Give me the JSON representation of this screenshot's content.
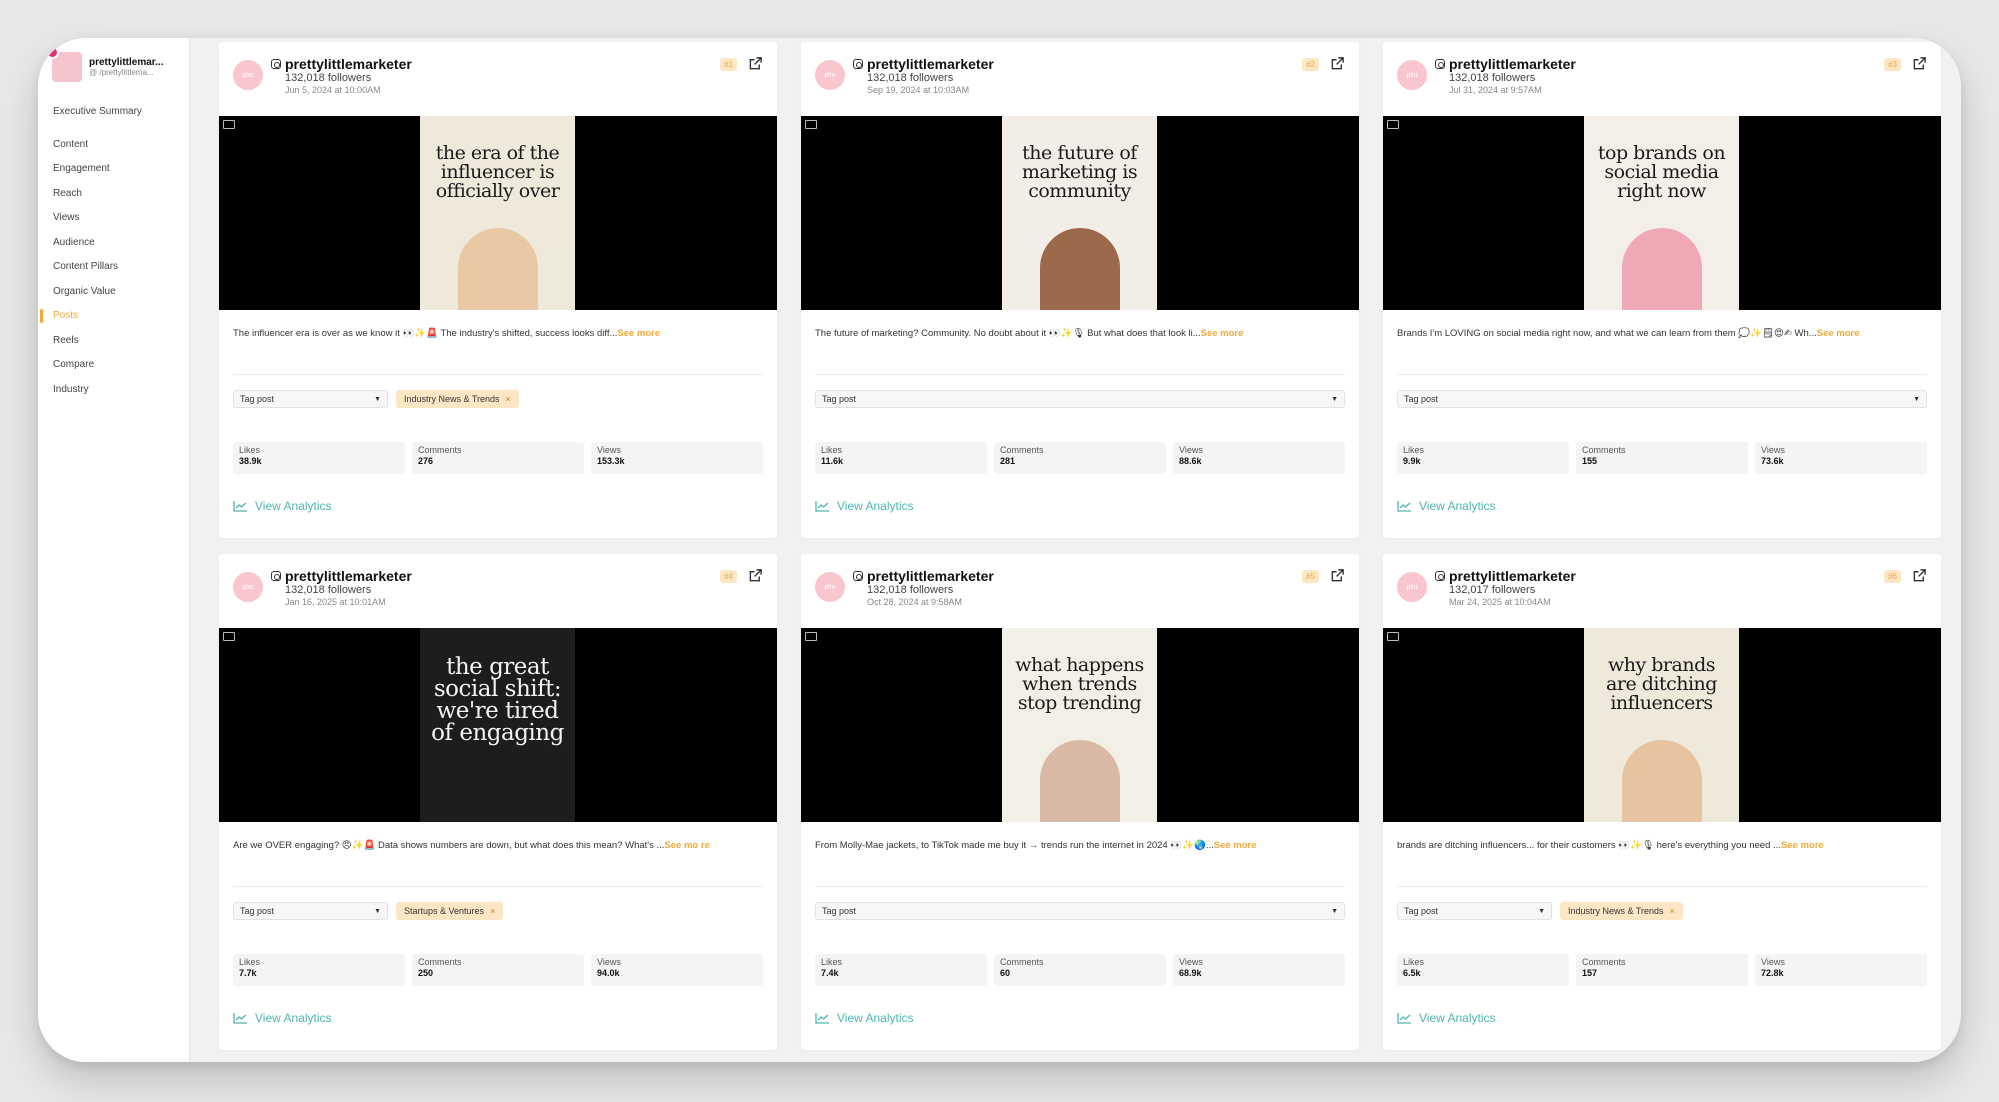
{
  "sidebar": {
    "profile_name": "prettylittlemar...",
    "profile_handle": "@ /prettylittlema...",
    "items": [
      {
        "label": "Executive Summary",
        "active": false
      },
      {
        "label": "Content",
        "active": false
      },
      {
        "label": "Engagement",
        "active": false
      },
      {
        "label": "Reach",
        "active": false
      },
      {
        "label": "Views",
        "active": false
      },
      {
        "label": "Audience",
        "active": false
      },
      {
        "label": "Content Pillars",
        "active": false
      },
      {
        "label": "Organic Value",
        "active": false
      },
      {
        "label": "Posts",
        "active": true
      },
      {
        "label": "Reels",
        "active": false
      },
      {
        "label": "Compare",
        "active": false
      },
      {
        "label": "Industry",
        "active": false
      }
    ]
  },
  "colors": {
    "accent": "#f0a93b",
    "analytics_link": "#4fb5b0",
    "chip_bg": "#fde6c4",
    "instagram_badge": "#e5306b"
  },
  "labels": {
    "see_more": "See more",
    "tag_placeholder": "Tag post",
    "likes": "Likes",
    "comments": "Comments",
    "views": "Views",
    "view_analytics": "View Analytics",
    "external_link_icon": "external-link-icon",
    "analytics_icon": "line-chart-icon"
  },
  "posts": [
    {
      "username": "prettylittlemarketer",
      "followers": "132,018 followers",
      "date": "Jun 5, 2024 at 10:00AM",
      "rank": "#1",
      "thumb_text": "the era of the influencer is officially over",
      "thumb_dark": false,
      "caption": "The influencer era is over as we know it 👀✨🚨 The industry's shifted, success looks diff...",
      "see_more": "See more",
      "tag": "Industry News & Trends",
      "likes": "38.9k",
      "comments": "276",
      "views": "153.3k"
    },
    {
      "username": "prettylittlemarketer",
      "followers": "132,018 followers",
      "date": "Sep 19, 2024 at 10:03AM",
      "rank": "#2",
      "thumb_text": "the future of marketing is community",
      "thumb_dark": false,
      "caption": "The future of marketing? Community. No doubt about it 👀✨🎙 But what does that look li...",
      "see_more": "See more",
      "tag": "",
      "likes": "11.6k",
      "comments": "281",
      "views": "88.6k"
    },
    {
      "username": "prettylittlemarketer",
      "followers": "132,018 followers",
      "date": "Jul 31, 2024 at 9:57AM",
      "rank": "#3",
      "thumb_text": "top brands on social media right now",
      "thumb_dark": false,
      "caption": "Brands I'm LOVING on social media right now, and what we can learn from them 💭✨🗒😍✍ Wh...",
      "see_more": "See more",
      "tag": "",
      "likes": "9.9k",
      "comments": "155",
      "views": "73.6k"
    },
    {
      "username": "prettylittlemarketer",
      "followers": "132,018 followers",
      "date": "Jan 16, 2025 at 10:01AM",
      "rank": "#4",
      "thumb_text": "the great social shift: we're tired of engaging",
      "thumb_dark": true,
      "caption": "Are we OVER engaging? 😠✨🚨 Data shows numbers are down, but what does this mean? What's ...",
      "see_more": "See mo re",
      "tag": "Startups & Ventures",
      "likes": "7.7k",
      "comments": "250",
      "views": "94.0k"
    },
    {
      "username": "prettylittlemarketer",
      "followers": "132,018 followers",
      "date": "Oct 28, 2024 at 9:58AM",
      "rank": "#5",
      "thumb_text": "what happens when trends stop trending",
      "thumb_dark": false,
      "caption": "From Molly-Mae jackets, to TikTok made me buy it → trends run the internet in 2024 👀✨🌏...",
      "see_more": "See more",
      "tag": "",
      "likes": "7.4k",
      "comments": "60",
      "views": "68.9k"
    },
    {
      "username": "prettylittlemarketer",
      "followers": "132,017 followers",
      "date": "Mar 24, 2025 at 10:04AM",
      "rank": "#6",
      "thumb_text": "why brands are ditching influencers",
      "thumb_dark": false,
      "caption": "brands are ditching influencers... for their customers 👀✨🎙 here's everything you need ...",
      "see_more": "See more",
      "tag": "Industry News & Trends",
      "likes": "6.5k",
      "comments": "157",
      "views": "72.8k"
    }
  ]
}
